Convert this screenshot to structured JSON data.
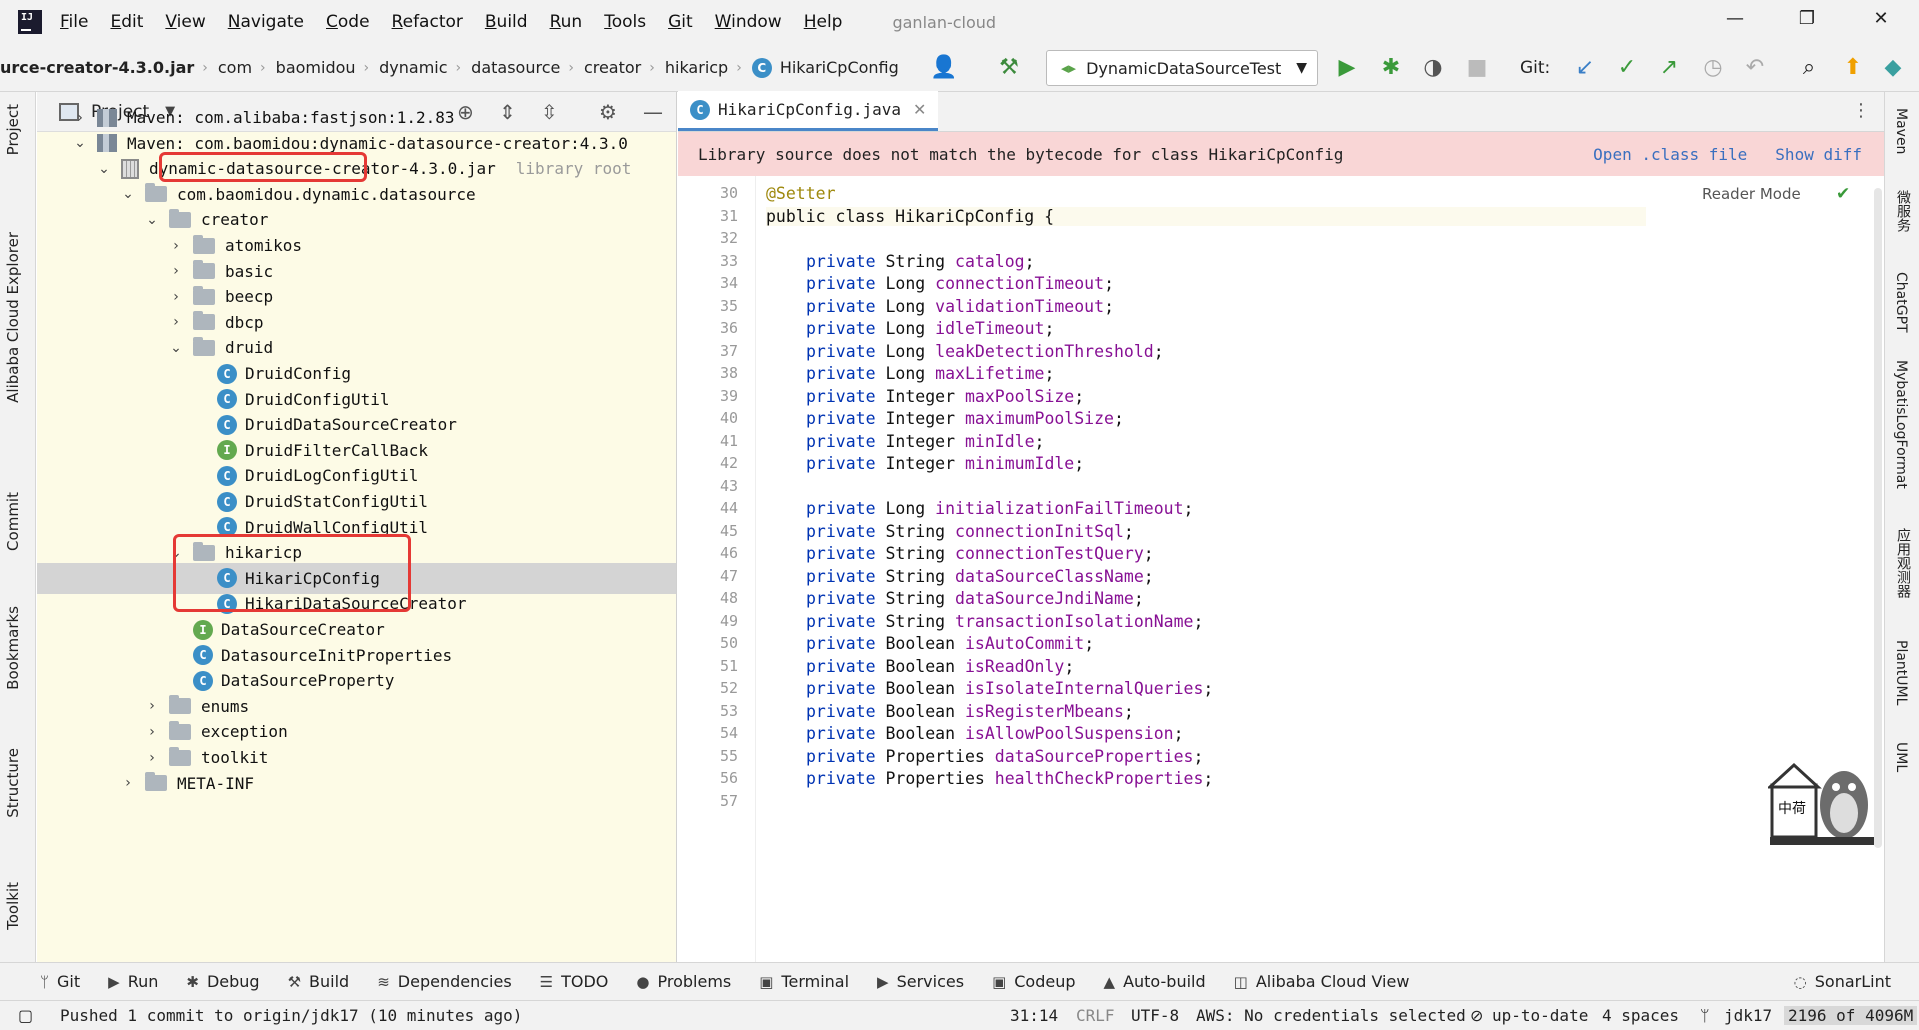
{
  "menubar": {
    "items": [
      "File",
      "Edit",
      "View",
      "Navigate",
      "Code",
      "Refactor",
      "Build",
      "Run",
      "Tools",
      "Git",
      "Window",
      "Help"
    ],
    "project_name": "ganlan-cloud"
  },
  "breadcrumb": [
    "urce-creator-4.3.0.jar",
    "com",
    "baomidou",
    "dynamic",
    "datasource",
    "creator",
    "hikaricp",
    "HikariCpConfig"
  ],
  "toolbar": {
    "run_config": "DynamicDataSourceTest",
    "git_label": "Git:"
  },
  "project_panel": {
    "title": "Project",
    "rows": [
      {
        "label": "Maven: com.alibaba:fastjson:1.2.83",
        "indent": 1,
        "chev": "›",
        "icon": "lib"
      },
      {
        "label": "Maven: com.baomidou:dynamic-datasource-creator:4.3.0",
        "indent": 1,
        "chev": "⌄",
        "icon": "lib"
      },
      {
        "label": "dynamic-datasource-creator-4.3.0.jar",
        "indent": 2,
        "chev": "⌄",
        "icon": "jar",
        "suffix": "library root"
      },
      {
        "label": "com.baomidou.dynamic.datasource",
        "indent": 3,
        "chev": "⌄",
        "icon": "folder"
      },
      {
        "label": "creator",
        "indent": 4,
        "chev": "⌄",
        "icon": "folder"
      },
      {
        "label": "atomikos",
        "indent": 5,
        "chev": "›",
        "icon": "folder"
      },
      {
        "label": "basic",
        "indent": 5,
        "chev": "›",
        "icon": "folder"
      },
      {
        "label": "beecp",
        "indent": 5,
        "chev": "›",
        "icon": "folder"
      },
      {
        "label": "dbcp",
        "indent": 5,
        "chev": "›",
        "icon": "folder"
      },
      {
        "label": "druid",
        "indent": 5,
        "chev": "⌄",
        "icon": "folder"
      },
      {
        "label": "DruidConfig",
        "indent": 6,
        "chev": "",
        "icon": "class"
      },
      {
        "label": "DruidConfigUtil",
        "indent": 6,
        "chev": "",
        "icon": "class"
      },
      {
        "label": "DruidDataSourceCreator",
        "indent": 6,
        "chev": "",
        "icon": "class"
      },
      {
        "label": "DruidFilterCallBack",
        "indent": 6,
        "chev": "",
        "icon": "interface"
      },
      {
        "label": "DruidLogConfigUtil",
        "indent": 6,
        "chev": "",
        "icon": "class"
      },
      {
        "label": "DruidStatConfigUtil",
        "indent": 6,
        "chev": "",
        "icon": "class"
      },
      {
        "label": "DruidWallConfigUtil",
        "indent": 6,
        "chev": "",
        "icon": "class"
      },
      {
        "label": "hikaricp",
        "indent": 5,
        "chev": "⌄",
        "icon": "folder"
      },
      {
        "label": "HikariCpConfig",
        "indent": 6,
        "chev": "",
        "icon": "class",
        "selected": true
      },
      {
        "label": "HikariDataSourceCreator",
        "indent": 6,
        "chev": "",
        "icon": "class"
      },
      {
        "label": "DataSourceCreator",
        "indent": 5,
        "chev": "",
        "icon": "interface"
      },
      {
        "label": "DatasourceInitProperties",
        "indent": 5,
        "chev": "",
        "icon": "class"
      },
      {
        "label": "DataSourceProperty",
        "indent": 5,
        "chev": "",
        "icon": "class"
      },
      {
        "label": "enums",
        "indent": 4,
        "chev": "›",
        "icon": "folder"
      },
      {
        "label": "exception",
        "indent": 4,
        "chev": "›",
        "icon": "folder"
      },
      {
        "label": "toolkit",
        "indent": 4,
        "chev": "›",
        "icon": "folder"
      },
      {
        "label": "META-INF",
        "indent": 3,
        "chev": "›",
        "icon": "folder"
      }
    ]
  },
  "editor": {
    "tab": "HikariCpConfig.java",
    "banner": "Library source does not match the bytecode for class HikariCpConfig",
    "open_class": "Open .class file",
    "show_diff": "Show diff",
    "reader_mode": "Reader Mode",
    "lines": [
      {
        "n": "30",
        "t": "@Setter",
        "kind": "ann"
      },
      {
        "n": "31",
        "t": "public class HikariCpConfig {",
        "kind": "class"
      },
      {
        "n": "32",
        "t": "",
        "kind": "blank"
      },
      {
        "n": "33",
        "type": "String",
        "name": "catalog"
      },
      {
        "n": "34",
        "type": "Long",
        "name": "connectionTimeout"
      },
      {
        "n": "35",
        "type": "Long",
        "name": "validationTimeout"
      },
      {
        "n": "36",
        "type": "Long",
        "name": "idleTimeout"
      },
      {
        "n": "37",
        "type": "Long",
        "name": "leakDetectionThreshold"
      },
      {
        "n": "38",
        "type": "Long",
        "name": "maxLifetime"
      },
      {
        "n": "39",
        "type": "Integer",
        "name": "maxPoolSize"
      },
      {
        "n": "40",
        "type": "Integer",
        "name": "maximumPoolSize"
      },
      {
        "n": "41",
        "type": "Integer",
        "name": "minIdle"
      },
      {
        "n": "42",
        "type": "Integer",
        "name": "minimumIdle"
      },
      {
        "n": "43",
        "t": "",
        "kind": "blank"
      },
      {
        "n": "44",
        "type": "Long",
        "name": "initializationFailTimeout"
      },
      {
        "n": "45",
        "type": "String",
        "name": "connectionInitSql"
      },
      {
        "n": "46",
        "type": "String",
        "name": "connectionTestQuery"
      },
      {
        "n": "47",
        "type": "String",
        "name": "dataSourceClassName"
      },
      {
        "n": "48",
        "type": "String",
        "name": "dataSourceJndiName"
      },
      {
        "n": "49",
        "type": "String",
        "name": "transactionIsolationName"
      },
      {
        "n": "50",
        "type": "Boolean",
        "name": "isAutoCommit"
      },
      {
        "n": "51",
        "type": "Boolean",
        "name": "isReadOnly"
      },
      {
        "n": "52",
        "type": "Boolean",
        "name": "isIsolateInternalQueries"
      },
      {
        "n": "53",
        "type": "Boolean",
        "name": "isRegisterMbeans"
      },
      {
        "n": "54",
        "type": "Boolean",
        "name": "isAllowPoolSuspension"
      },
      {
        "n": "55",
        "type": "Properties",
        "name": "dataSourceProperties"
      },
      {
        "n": "56",
        "type": "Properties",
        "name": "healthCheckProperties"
      },
      {
        "n": "57",
        "t": "",
        "kind": "blank"
      }
    ]
  },
  "left_tabs": [
    "Project",
    "Alibaba Cloud Explorer",
    "Commit",
    "Bookmarks",
    "Structure",
    "Toolkit"
  ],
  "right_tabs": [
    "Maven",
    "微服务",
    "ChatGPT",
    "MybatisLogFormat",
    "应用观测器",
    "PlantUML",
    "UML"
  ],
  "bottom_tools": [
    "Git",
    "Run",
    "Debug",
    "Build",
    "Dependencies",
    "TODO",
    "Problems",
    "Terminal",
    "Services",
    "Codeup",
    "Auto-build",
    "Alibaba Cloud View",
    "SonarLint"
  ],
  "status": {
    "message": "Pushed 1 commit to origin/jdk17 (10 minutes ago)",
    "position": "31:14",
    "line_sep": "CRLF",
    "encoding": "UTF-8",
    "aws": "AWS: No credentials selected",
    "vcs": "up-to-date",
    "indent": "4 spaces",
    "branch": "jdk17",
    "memory": "2196 of 4096M"
  },
  "colors": {
    "keyword": "#0033b3",
    "field": "#871094",
    "annotation": "#9e880d",
    "banner_bg": "#f9d6d6",
    "highlight_box": "#e53935"
  }
}
